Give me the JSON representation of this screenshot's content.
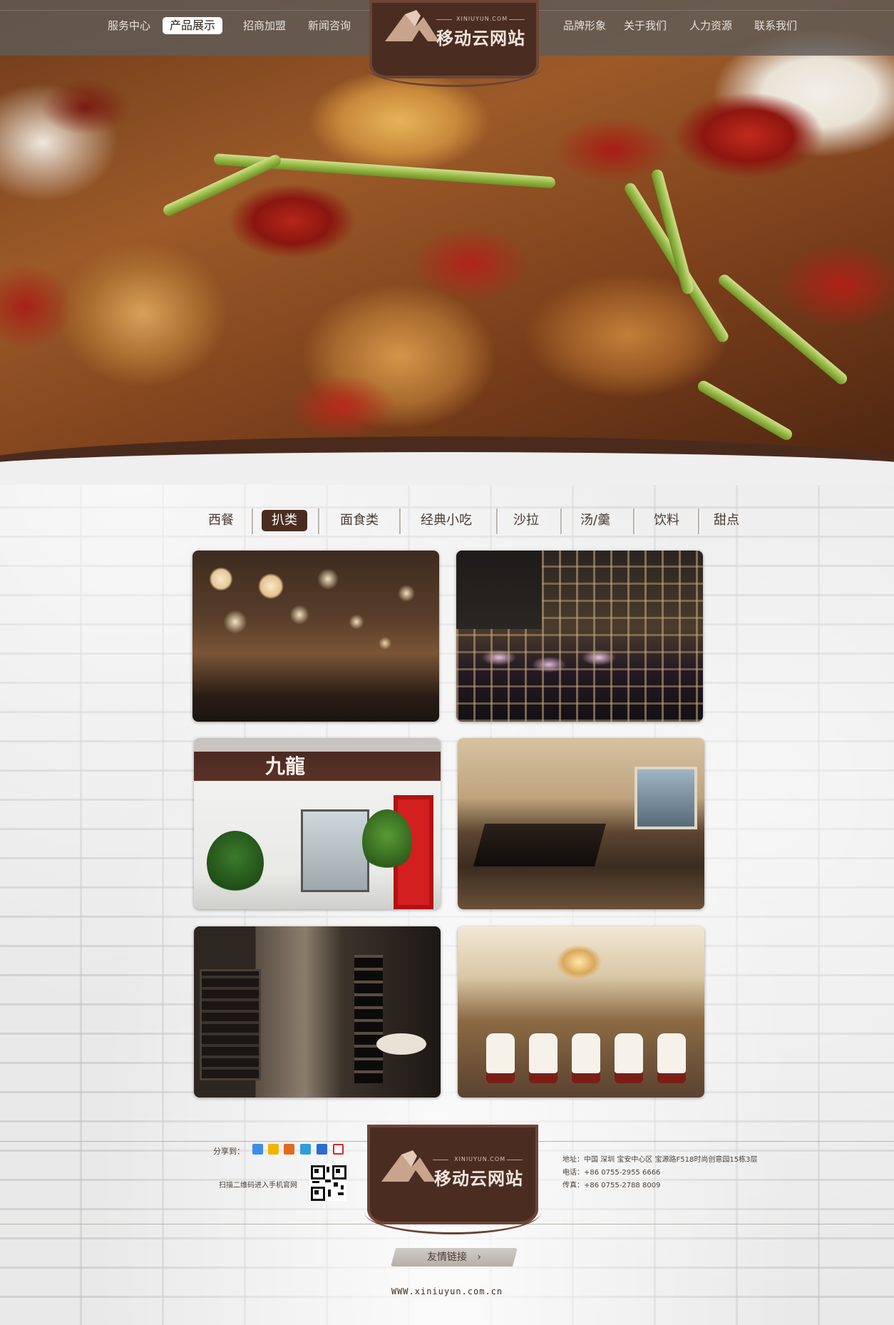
{
  "nav": {
    "left": [
      "服务中心",
      "产品展示",
      "招商加盟",
      "新闻咨询"
    ],
    "active_index": 1,
    "right": [
      "品牌形象",
      "关于我们",
      "人力资源",
      "联系我们"
    ]
  },
  "logo": {
    "name": "移动云网站",
    "domain_text": "XINIUYUN.COM"
  },
  "categories": {
    "items": [
      "西餐",
      "扒类",
      "面食类",
      "经典小吃",
      "沙拉",
      "汤/羹",
      "饮料",
      "甜点"
    ],
    "active_index": 1
  },
  "gallery": {
    "photo3_sign": "九龍"
  },
  "footer": {
    "share_label": "分享到：",
    "share_icons": [
      "qq-space-icon",
      "favorite-icon",
      "rss-icon",
      "pengyou-icon",
      "renren-icon",
      "weibo-icon"
    ],
    "share_colors": [
      "#3a8ee6",
      "#f0b400",
      "#e36a1e",
      "#2e9de0",
      "#2c6bcf",
      "#d8262b"
    ],
    "qr_label": "扫描二维码进入手机官网",
    "address": "地址：中国 深圳 宝安中心区 宝源路F518时尚创意园15栋3层",
    "phone": "电话：+86 0755-2955 6666",
    "fax": "传真：+86 0755-2788 8009",
    "friend_links": "友情链接",
    "website": "WWW.xiniuyun.com.cn"
  },
  "colors": {
    "brand_brown": "#4b2c21",
    "active_tab": "#4a2c21"
  }
}
